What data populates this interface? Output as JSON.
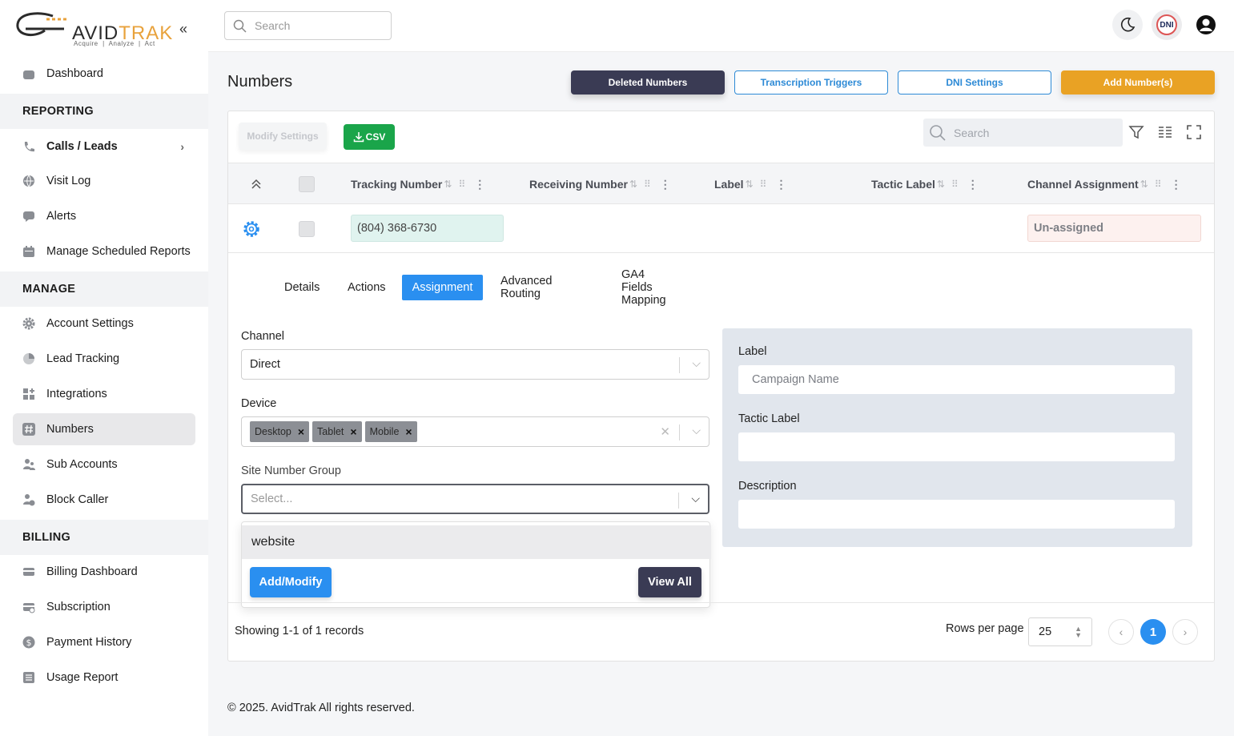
{
  "brand": {
    "name_part1": "AVID",
    "name_part2": "TRAK",
    "tagline": "Acquire  |  Analyze  |  Act"
  },
  "sidebar": {
    "items": [
      {
        "label": "Dashboard",
        "icon": "home-icon"
      },
      {
        "label": "Calls / Leads",
        "icon": "phone-icon"
      },
      {
        "label": "Visit Log",
        "icon": "globe-icon"
      },
      {
        "label": "Alerts",
        "icon": "chat-bubble-icon"
      },
      {
        "label": "Manage Scheduled Reports",
        "icon": "calendar-icon"
      },
      {
        "label": "Account Settings",
        "icon": "gear-icon"
      },
      {
        "label": "Lead Tracking",
        "icon": "pie-chart-icon"
      },
      {
        "label": "Integrations",
        "icon": "grid-plus-icon"
      },
      {
        "label": "Numbers",
        "icon": "hash-icon"
      },
      {
        "label": "Sub Accounts",
        "icon": "users-icon"
      },
      {
        "label": "Block Caller",
        "icon": "user-block-icon"
      },
      {
        "label": "Billing Dashboard",
        "icon": "card-icon"
      },
      {
        "label": "Subscription",
        "icon": "card-sync-icon"
      },
      {
        "label": "Payment History",
        "icon": "dollar-icon"
      },
      {
        "label": "Usage Report",
        "icon": "list-icon"
      }
    ],
    "sections": {
      "reporting": "REPORTING",
      "manage": "MANAGE",
      "billing": "BILLING"
    }
  },
  "topbar": {
    "search_placeholder": "Search",
    "dni_label": "DNI"
  },
  "page": {
    "title": "Numbers",
    "buttons": {
      "deleted": "Deleted Numbers",
      "transcription": "Transcription Triggers",
      "dni_settings": "DNI Settings",
      "add": "Add Number(s)"
    }
  },
  "table": {
    "modify_settings": "Modify Settings",
    "csv": "CSV",
    "search_placeholder": "Search",
    "columns": [
      "Tracking Number",
      "Receiving Number",
      "Label",
      "Tactic Label",
      "Channel Assignment"
    ],
    "rows": [
      {
        "tracking_number": "(804) 368-6730",
        "receiving_number": "",
        "label": "",
        "tactic_label": "",
        "channel_assignment": "Un-assigned"
      }
    ]
  },
  "detail": {
    "tabs": [
      "Details",
      "Actions",
      "Assignment",
      "Advanced Routing",
      "GA4 Fields Mapping"
    ],
    "active_tab": "Assignment",
    "channel": {
      "label": "Channel",
      "value": "Direct"
    },
    "device": {
      "label": "Device",
      "chips": [
        "Desktop",
        "Tablet",
        "Mobile"
      ]
    },
    "site_number_group": {
      "label": "Site Number Group",
      "placeholder": "Select...",
      "options": [
        "website"
      ],
      "add_modify": "Add/Modify",
      "view_all": "View All"
    },
    "right": {
      "label_title": "Label",
      "label_placeholder": "Campaign Name",
      "tactic_title": "Tactic Label",
      "description_title": "Description"
    }
  },
  "pagination": {
    "showing": "Showing 1-1 of 1 records",
    "rows_per_page_label": "Rows per page",
    "rows_per_page": "25",
    "current_page": "1"
  },
  "footer": {
    "copyright": "© 2025. AvidTrak All rights reserved."
  },
  "colors": {
    "accent": "#2a8ff0",
    "brand_orange": "#e9a224",
    "dark_button": "#3a3b54",
    "csv_green": "#1aa54a"
  }
}
